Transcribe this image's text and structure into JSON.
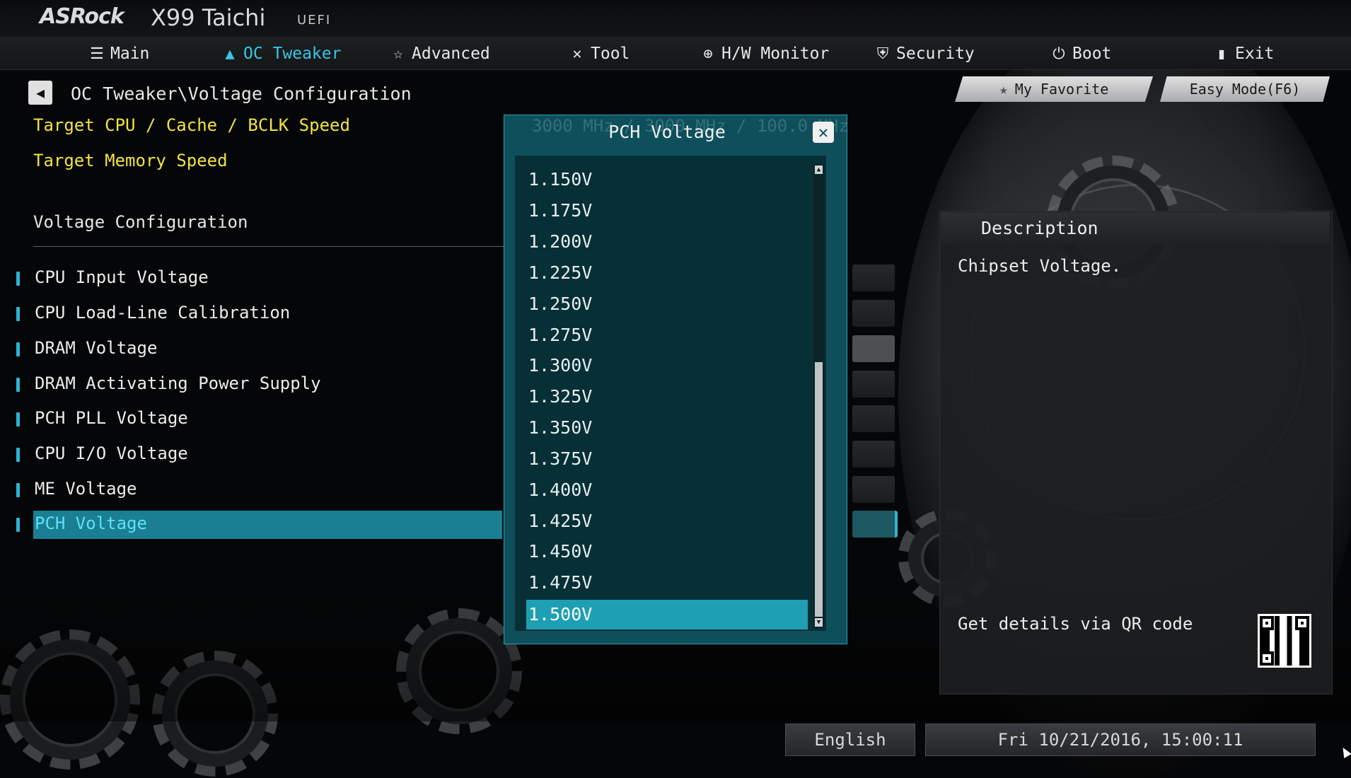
{
  "header": {
    "brand": "ASRock",
    "model": "X99 Taichi",
    "uefi": "UEFI"
  },
  "nav": [
    {
      "label": "Main",
      "icon": "list-icon"
    },
    {
      "label": "OC Tweaker",
      "icon": "rocket-icon",
      "active": true
    },
    {
      "label": "Advanced",
      "icon": "star-icon"
    },
    {
      "label": "Tool",
      "icon": "tools-icon"
    },
    {
      "label": "H/W Monitor",
      "icon": "crosshair-icon"
    },
    {
      "label": "Security",
      "icon": "shield-icon"
    },
    {
      "label": "Boot",
      "icon": "power-icon"
    },
    {
      "label": "Exit",
      "icon": "exit-door-icon"
    }
  ],
  "breadcrumb": "OC Tweaker\\Voltage Configuration",
  "settings": {
    "target_cpu": "Target CPU / Cache / BCLK Speed",
    "target_memory": "Target Memory Speed",
    "section_title": "Voltage Configuration",
    "items": [
      {
        "label": "CPU Input Voltage"
      },
      {
        "label": "CPU Load-Line Calibration"
      },
      {
        "label": "DRAM Voltage"
      },
      {
        "label": "DRAM Activating Power Supply"
      },
      {
        "label": "PCH PLL Voltage"
      },
      {
        "label": "CPU I/O Voltage"
      },
      {
        "label": "ME Voltage"
      },
      {
        "label": "PCH Voltage",
        "selected": true
      }
    ]
  },
  "top_buttons": {
    "favorite": "My Favorite",
    "easy_mode": "Easy Mode(F6)"
  },
  "description": {
    "title": "Description",
    "text": "Chipset Voltage.",
    "qr_label": "Get details via QR code"
  },
  "footer": {
    "language": "English",
    "datetime": "Fri 10/21/2016, 15:00:11"
  },
  "popup": {
    "title": "PCH Voltage",
    "ghost_text": "3000 MHz / 3000 MHz / 100.0 MHz",
    "options": [
      "1.150V",
      "1.175V",
      "1.200V",
      "1.225V",
      "1.250V",
      "1.275V",
      "1.300V",
      "1.325V",
      "1.350V",
      "1.375V",
      "1.400V",
      "1.425V",
      "1.450V",
      "1.475V",
      "1.500V"
    ],
    "selected": "1.500V"
  },
  "colors": {
    "accent": "#37c6e4",
    "highlight": "#1a7f93",
    "popup_bg": "#0f4f5b",
    "target_text": "#f0e442"
  }
}
